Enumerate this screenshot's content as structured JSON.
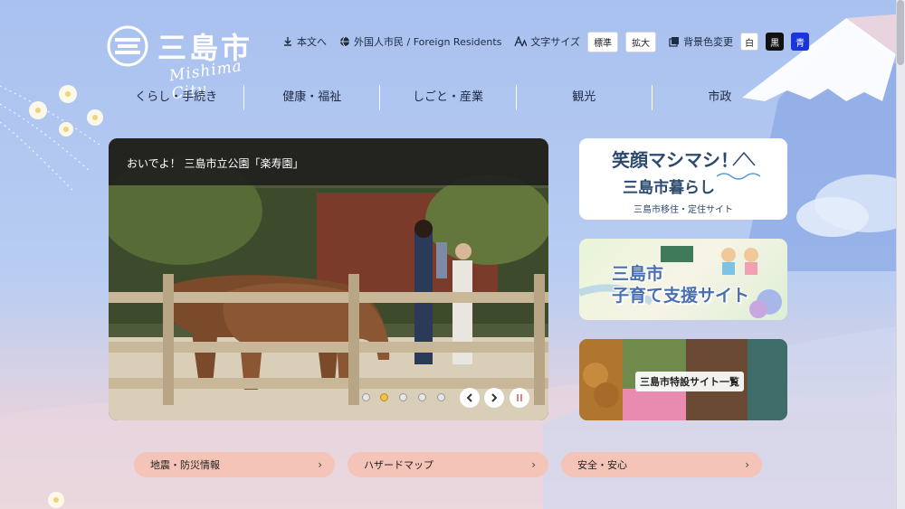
{
  "logo": {
    "name": "三島市",
    "romaji": "Mishima City"
  },
  "utility": {
    "skip_label": "本文へ",
    "foreign_label": "外国人市民 / Foreign Residents",
    "font_size_label": "文字サイズ",
    "font_size_options": [
      "標準",
      "拡大"
    ],
    "bg_color_label": "背景色変更",
    "bg_color_options": [
      "白",
      "黒",
      "青"
    ]
  },
  "nav": {
    "items": [
      "くらし・手続き",
      "健康・福祉",
      "しごと・産業",
      "観光",
      "市政"
    ]
  },
  "slider": {
    "caption": "おいでよ！ 三島市立公園「楽寿園」",
    "slide_count": 5,
    "active_index": 1,
    "prev_icon": "chevron-left-icon",
    "next_icon": "chevron-right-icon",
    "pause_icon": "pause-icon"
  },
  "banners": [
    {
      "line1": "笑顔マシマシ！",
      "line2": "三島市暮らし",
      "line3": "三島市移住・定住サイト"
    },
    {
      "line1": "三島市",
      "line2": "子育て支援サイト"
    },
    {
      "line1": "三島市特設サイト一覧"
    }
  ],
  "quick_links": [
    {
      "label": "地震・防災情報",
      "icon": "chevron-right-icon"
    },
    {
      "label": "ハザードマップ",
      "icon": "chevron-right-icon"
    },
    {
      "label": "安全・安心",
      "icon": "chevron-right-icon"
    }
  ],
  "colors": {
    "bg_top": "#a9c1ef",
    "bg_bottom": "#f3dcd8",
    "pill": "#f4c4b8",
    "accent_blue": "#1a35d8"
  }
}
